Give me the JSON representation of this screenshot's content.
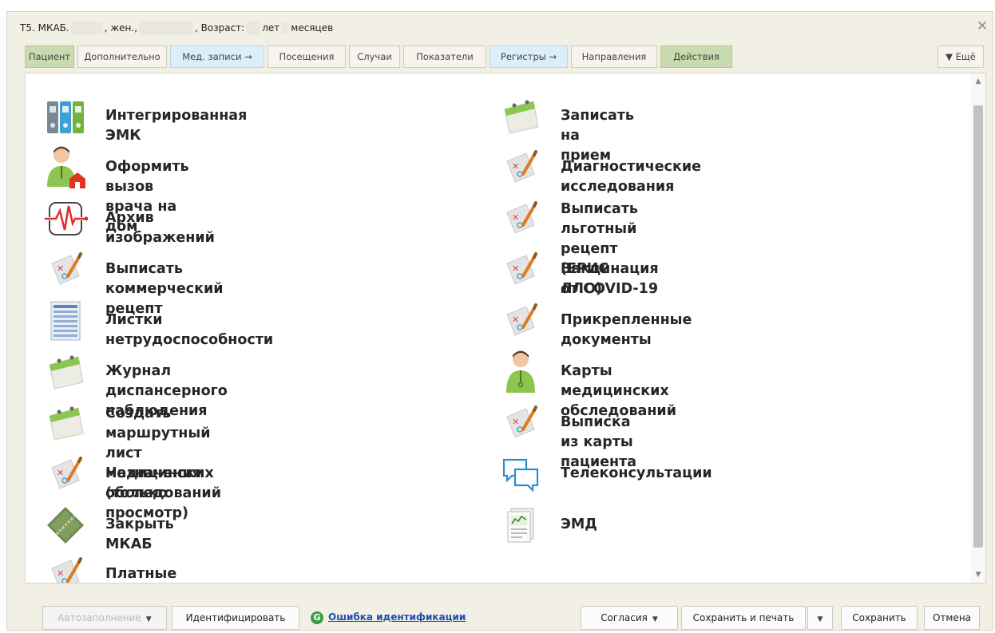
{
  "titlebar": {
    "prefix": "Т5. МКАБ.",
    "gender": ", жен., ",
    "age_label": ", Возраст:",
    "years": "лет",
    "months": "месяцев",
    "close_icon": "close-icon"
  },
  "tabs": [
    {
      "label": "Пациент"
    },
    {
      "label": "Дополнительно"
    },
    {
      "label": "Мед. записи →"
    },
    {
      "label": "Посещения"
    },
    {
      "label": "Случаи"
    },
    {
      "label": "Показатели"
    },
    {
      "label": "Регистры →"
    },
    {
      "label": "Направления"
    },
    {
      "label": "Действия"
    },
    {
      "label": "▼ Ещё"
    }
  ],
  "actions": {
    "left": [
      {
        "label": "Интегрированная ЭМК",
        "icon": "binders-icon"
      },
      {
        "label": "Оформить вызов врача на дом",
        "icon": "doctor-home-icon"
      },
      {
        "label": "Архив изображений",
        "icon": "heartbeat-icon"
      },
      {
        "label": "Выписать коммерческий рецепт",
        "icon": "prescription-icon"
      },
      {
        "label": "Листки нетрудоспособности",
        "icon": "sick-leave-sheet-icon"
      },
      {
        "label": "Журнал диспансерного наблюдения",
        "icon": "calendar-icon"
      },
      {
        "label": "Создать маршрутный лист\nмедицинских обследований",
        "icon": "calendar-icon"
      },
      {
        "label": "Назначения (только просмотр)",
        "icon": "prescription-icon"
      },
      {
        "label": "Закрыть МКАБ",
        "icon": "closed-book-icon"
      },
      {
        "label": "Платные услуги",
        "icon": "prescription-icon"
      }
    ],
    "right": [
      {
        "label": "Записать на прием",
        "icon": "calendar-icon"
      },
      {
        "label": "Диагностические исследования",
        "icon": "prescription-icon"
      },
      {
        "label": "Выписать льготный рецепт\n(ЕРИС ЛЛО)",
        "icon": "prescription-icon"
      },
      {
        "label": "Вакцинация от COVID-19",
        "icon": "prescription-icon"
      },
      {
        "label": "Прикрепленные документы",
        "icon": "prescription-icon"
      },
      {
        "label": "Карты медицинских обследований",
        "icon": "doctor-icon"
      },
      {
        "label": "Выписка из карты пациента",
        "icon": "prescription-icon"
      },
      {
        "label": "Телеконсультации",
        "icon": "chat-bubbles-icon"
      },
      {
        "label": "ЭМД",
        "icon": "document-chart-icon"
      }
    ]
  },
  "footer": {
    "autofill": "Автозаполнение",
    "identify": "Идентифицировать",
    "identify_error": "Ошибка идентификации",
    "consents": "Согласия",
    "save_print": "Сохранить и печать",
    "save": "Сохранить",
    "cancel": "Отмена"
  },
  "colors": {
    "window_bg": "#f2efe4",
    "tab_green": "#c9dcb0",
    "tab_blue": "#dbeefa",
    "link": "#1f4eb4"
  }
}
